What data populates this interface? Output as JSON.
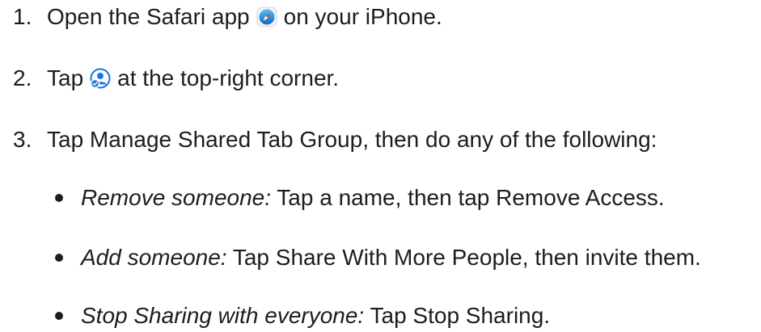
{
  "steps": [
    {
      "num": "1.",
      "before": "Open the Safari app",
      "icon": "safari-icon",
      "after": "on your iPhone."
    },
    {
      "num": "2.",
      "before": "Tap",
      "icon": "shared-tab-group-people-icon",
      "after": "at the top-right corner."
    },
    {
      "num": "3.",
      "text": "Tap Manage Shared Tab Group, then do any of the following:"
    }
  ],
  "bullets": [
    {
      "em": "Remove someone:",
      "text": " Tap a name, then tap Remove Access."
    },
    {
      "em": "Add someone:",
      "text": " Tap Share With More People, then invite them."
    },
    {
      "em": "Stop Sharing with everyone:",
      "text": " Tap Stop Sharing."
    }
  ],
  "colors": {
    "text": "#1d1d1f",
    "accent": "#1a73e8"
  }
}
